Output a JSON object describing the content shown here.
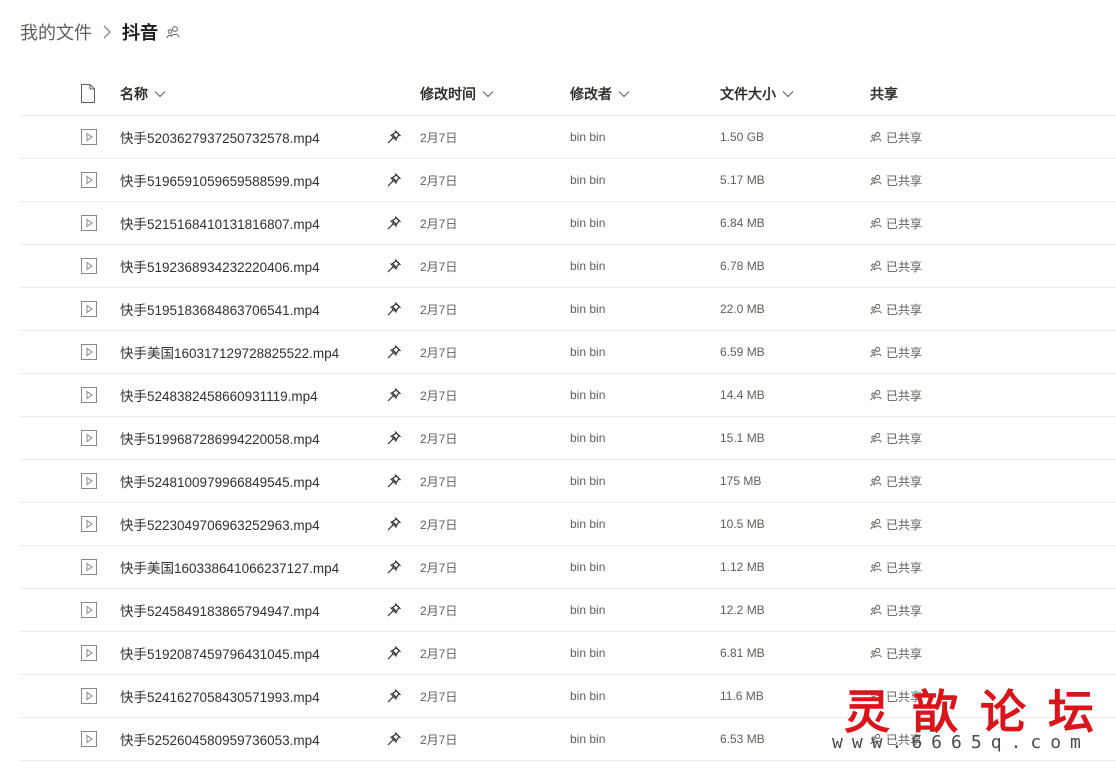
{
  "breadcrumb": {
    "root": "我的文件",
    "current": "抖音",
    "separator_icon": "chevron-right-icon",
    "share_icon": "people-icon"
  },
  "columns": {
    "type_icon": "document-icon",
    "name": "名称",
    "modified": "修改时间",
    "modified_by": "修改者",
    "size": "文件大小",
    "sharing": "共享",
    "sort_icon": "chevron-down-icon"
  },
  "files": [
    {
      "name": "快手5203627937250732578.mp4",
      "modified": "2月7日",
      "modified_by": "bin bin",
      "size": "1.50 GB",
      "sharing": "已共享"
    },
    {
      "name": "快手5196591059659588599.mp4",
      "modified": "2月7日",
      "modified_by": "bin bin",
      "size": "5.17 MB",
      "sharing": "已共享"
    },
    {
      "name": "快手5215168410131816807.mp4",
      "modified": "2月7日",
      "modified_by": "bin bin",
      "size": "6.84 MB",
      "sharing": "已共享"
    },
    {
      "name": "快手5192368934232220406.mp4",
      "modified": "2月7日",
      "modified_by": "bin bin",
      "size": "6.78 MB",
      "sharing": "已共享"
    },
    {
      "name": "快手5195183684863706541.mp4",
      "modified": "2月7日",
      "modified_by": "bin bin",
      "size": "22.0 MB",
      "sharing": "已共享"
    },
    {
      "name": "快手美国160317129728825522.mp4",
      "modified": "2月7日",
      "modified_by": "bin bin",
      "size": "6.59 MB",
      "sharing": "已共享"
    },
    {
      "name": "快手5248382458660931119.mp4",
      "modified": "2月7日",
      "modified_by": "bin bin",
      "size": "14.4 MB",
      "sharing": "已共享"
    },
    {
      "name": "快手5199687286994220058.mp4",
      "modified": "2月7日",
      "modified_by": "bin bin",
      "size": "15.1 MB",
      "sharing": "已共享"
    },
    {
      "name": "快手5248100979966849545.mp4",
      "modified": "2月7日",
      "modified_by": "bin bin",
      "size": "175 MB",
      "sharing": "已共享"
    },
    {
      "name": "快手5223049706963252963.mp4",
      "modified": "2月7日",
      "modified_by": "bin bin",
      "size": "10.5 MB",
      "sharing": "已共享"
    },
    {
      "name": "快手美国160338641066237127.mp4",
      "modified": "2月7日",
      "modified_by": "bin bin",
      "size": "1.12 MB",
      "sharing": "已共享"
    },
    {
      "name": "快手5245849183865794947.mp4",
      "modified": "2月7日",
      "modified_by": "bin bin",
      "size": "12.2 MB",
      "sharing": "已共享"
    },
    {
      "name": "快手5192087459796431045.mp4",
      "modified": "2月7日",
      "modified_by": "bin bin",
      "size": "6.81 MB",
      "sharing": "已共享"
    },
    {
      "name": "快手5241627058430571993.mp4",
      "modified": "2月7日",
      "modified_by": "bin bin",
      "size": "11.6 MB",
      "sharing": "已共享"
    },
    {
      "name": "快手5252604580959736053.mp4",
      "modified": "2月7日",
      "modified_by": "bin bin",
      "size": "6.53 MB",
      "sharing": "已共享"
    }
  ],
  "row_icons": {
    "file": "video-file-icon",
    "pin": "pin-icon",
    "share": "people-icon"
  },
  "watermark": {
    "title": "灵歆论坛",
    "url": "www.6665q.com",
    "color": "#d9141b"
  },
  "colors": {
    "text_primary": "#323130",
    "text_secondary": "#605e5c",
    "divider": "#edebe9"
  }
}
